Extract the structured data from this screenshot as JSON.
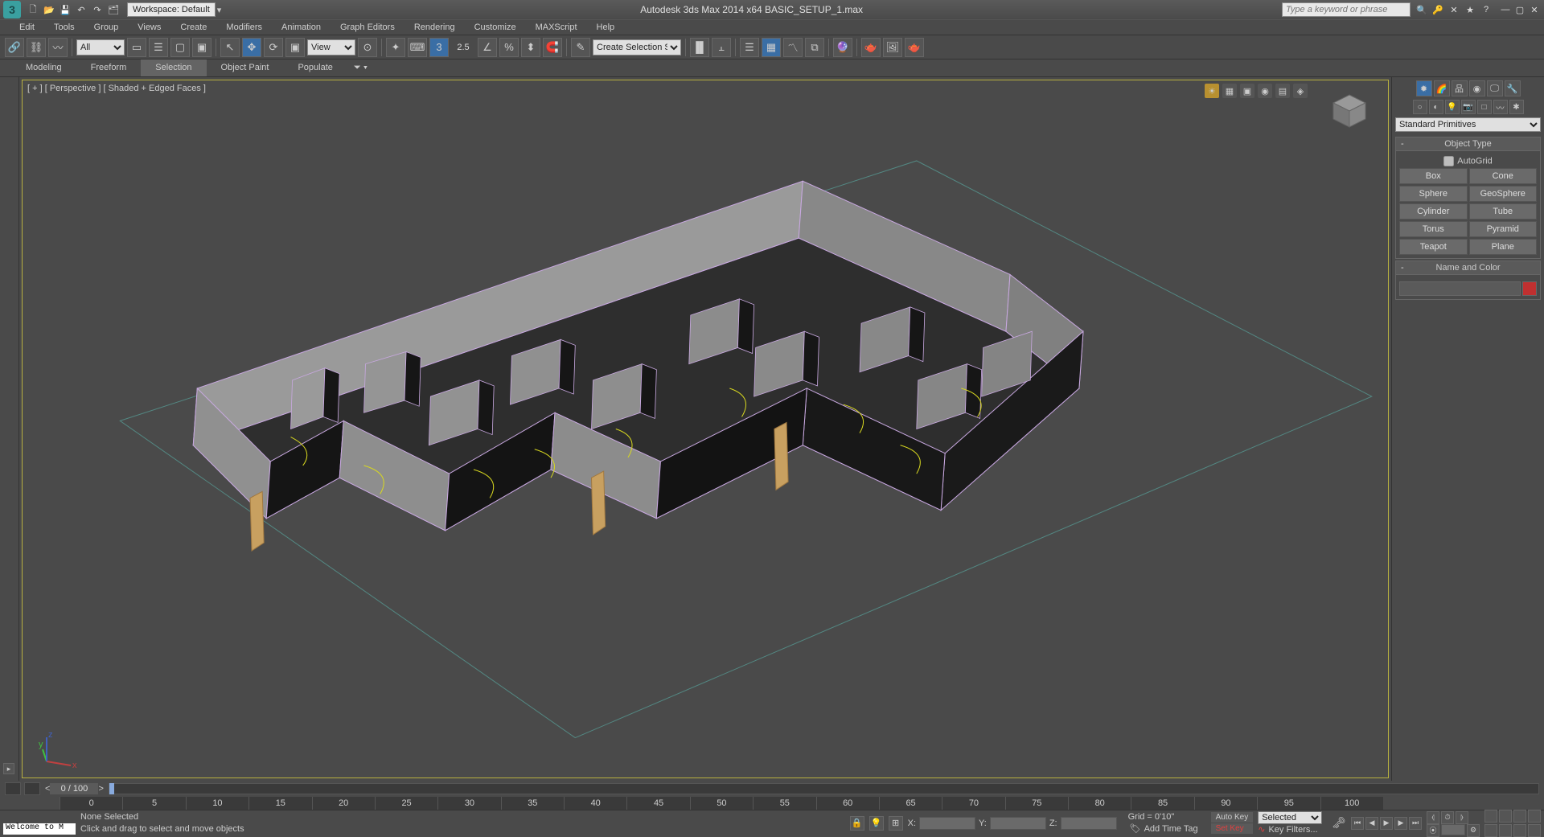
{
  "titlebar": {
    "workspace_label": "Workspace: Default",
    "app_title": "Autodesk 3ds Max  2014 x64      BASIC_SETUP_1.max",
    "search_placeholder": "Type a keyword or phrase"
  },
  "menubar": [
    "Edit",
    "Tools",
    "Group",
    "Views",
    "Create",
    "Modifiers",
    "Animation",
    "Graph Editors",
    "Rendering",
    "Customize",
    "MAXScript",
    "Help"
  ],
  "maintoolbar": {
    "selfilter": "All",
    "refcoord": "View",
    "spinner_value": "2.5",
    "named_sel": "Create Selection Se"
  },
  "ribbon": {
    "tabs": [
      "Modeling",
      "Freeform",
      "Selection",
      "Object Paint",
      "Populate"
    ],
    "active_index": 2
  },
  "viewport": {
    "label": "[ + ] [ Perspective ] [ Shaded + Edged Faces ]"
  },
  "command_panel": {
    "dropdown": "Standard Primitives",
    "object_type_header": "Object Type",
    "autogrid_label": "AutoGrid",
    "primitives": [
      "Box",
      "Cone",
      "Sphere",
      "GeoSphere",
      "Cylinder",
      "Tube",
      "Torus",
      "Pyramid",
      "Teapot",
      "Plane"
    ],
    "name_and_color_header": "Name and Color",
    "name_value": ""
  },
  "timeline": {
    "frame_display": "0 / 100",
    "ticks": [
      "0",
      "5",
      "10",
      "15",
      "20",
      "25",
      "30",
      "35",
      "40",
      "45",
      "50",
      "55",
      "60",
      "65",
      "70",
      "75",
      "80",
      "85",
      "90",
      "95",
      "100"
    ]
  },
  "statusbar": {
    "welcome": "Welcome to M",
    "selection": "None Selected",
    "prompt": "Click and drag to select and move objects",
    "x_label": "X:",
    "y_label": "Y:",
    "z_label": "Z:",
    "x": "",
    "y": "",
    "z": "",
    "grid": "Grid = 0'10\"",
    "add_time_tag": "Add Time Tag",
    "auto_key": "Auto Key",
    "set_key": "Set Key",
    "selected": "Selected",
    "key_filters": "Key Filters..."
  }
}
